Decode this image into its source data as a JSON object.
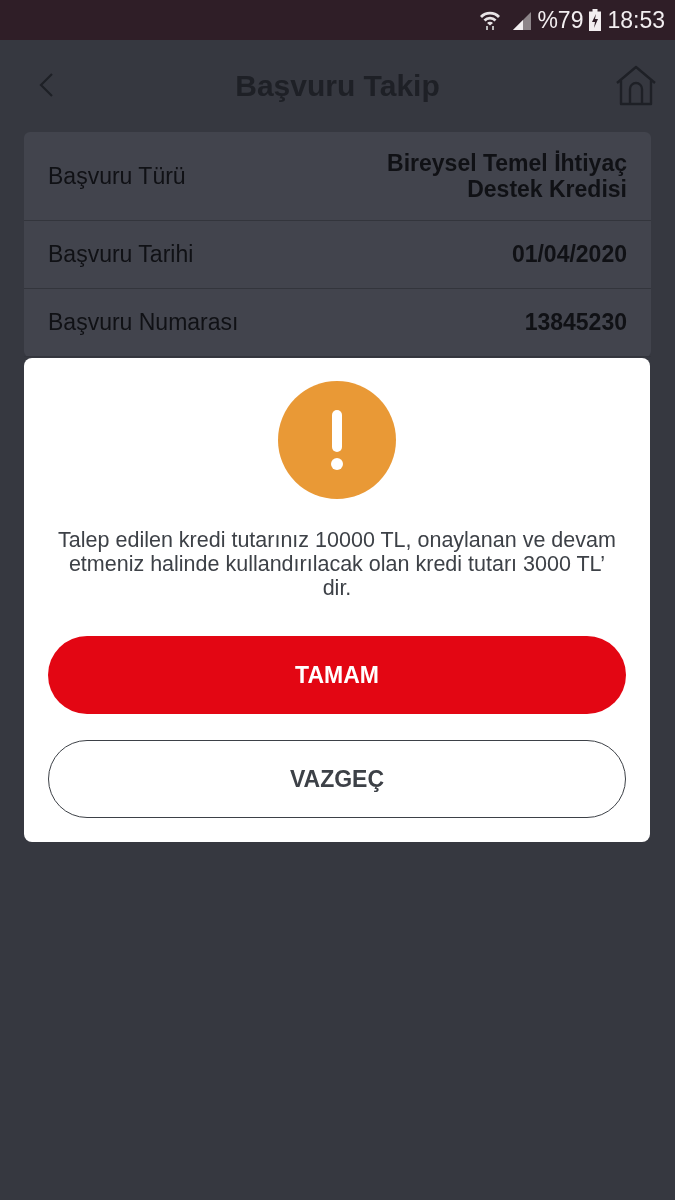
{
  "status_bar": {
    "battery": "%79",
    "time": "18:53"
  },
  "header": {
    "title": "Başvuru Takip"
  },
  "details": [
    {
      "label": "Başvuru Türü",
      "value": "Bireysel Temel İhtiyaç Destek Kredisi"
    },
    {
      "label": "Başvuru Tarihi",
      "value": "01/04/2020"
    },
    {
      "label": "Başvuru Numarası",
      "value": "13845230"
    }
  ],
  "dialog": {
    "message": "Talep edilen kredi tutarınız 10000 TL, onaylanan ve devam etmeniz halinde kullandırılacak olan kredi tutarı 3000 TL’ dir.",
    "buttons": [
      {
        "label": "TAMAM",
        "kind": "primary"
      },
      {
        "label": "VAZGEÇ",
        "kind": "secondary"
      }
    ]
  }
}
